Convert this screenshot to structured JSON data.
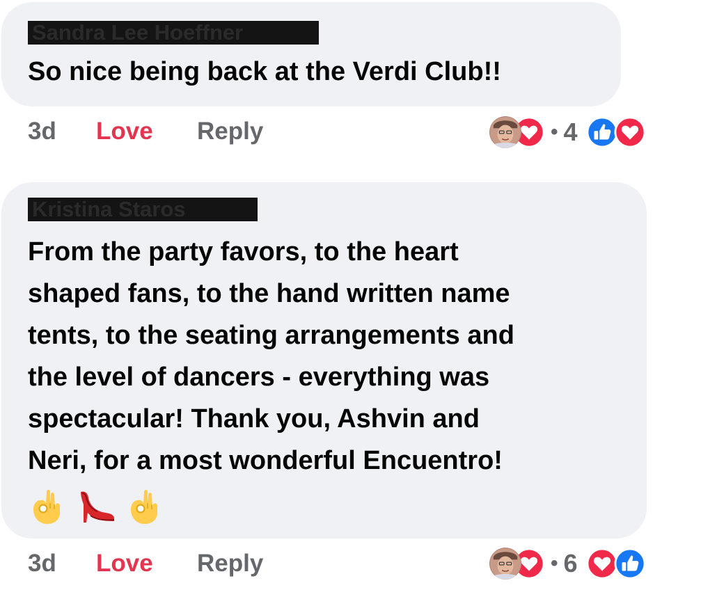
{
  "comments": [
    {
      "author": "Sandra Lee Hoeffner",
      "text_lines": [
        "So nice being back at the Verdi Club!!"
      ],
      "time": "3d",
      "love_label": "Love",
      "reply_label": "Reply",
      "reply_count_sep": "•",
      "reply_count": "4",
      "reaction_icons": [
        "like-icon",
        "love-icon"
      ]
    },
    {
      "author": "Kristina Staros",
      "text_lines": [
        "From the party favors, to the heart",
        "shaped fans, to the hand written name",
        "tents, to the seating arrangements and",
        "the level of dancers - everything was",
        "spectacular! Thank you, Ashvin and",
        "Neri, for a most wonderful Encuentro!"
      ],
      "emojis": [
        "ok-hand-emoji",
        "high-heel-emoji",
        "ok-hand-emoji"
      ],
      "time": "3d",
      "love_label": "Love",
      "reply_label": "Reply",
      "reply_count_sep": "•",
      "reply_count": "6",
      "reaction_icons": [
        "love-icon",
        "like-icon"
      ]
    }
  ],
  "colors": {
    "bubble": "#f0f1f4",
    "love": "#e2354f",
    "meta": "#65676b",
    "like_blue": "#1877f2",
    "heart_red": "#f02849"
  }
}
